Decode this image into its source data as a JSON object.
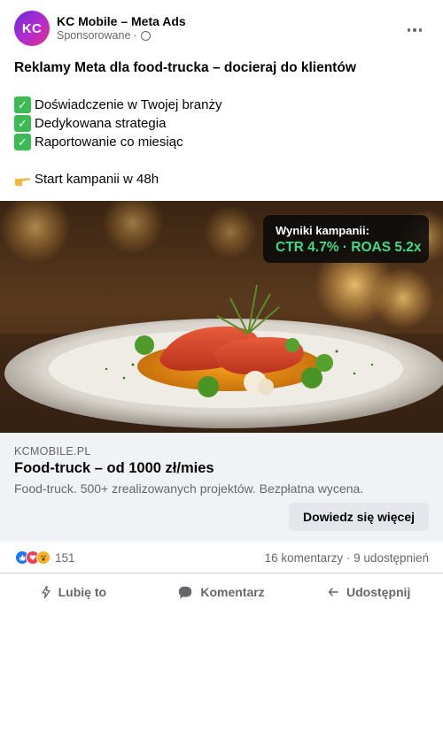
{
  "header": {
    "avatar_text": "KC",
    "page_name": "KC Mobile – Meta Ads",
    "sponsored": "Sponsorowane",
    "separator": "·"
  },
  "body": {
    "headline": "Reklamy Meta dla food-trucka – docieraj do klientów",
    "bullets": [
      "Doświadczenie w Twojej branży",
      "Dedykowana strategia",
      "Raportowanie co miesiąc"
    ],
    "cta_line": "Start kampanii w 48h"
  },
  "image": {
    "icon": "plated-dish-photo",
    "overlay_title": "Wyniki kampanii:",
    "overlay_value": "CTR 4.7% · ROAS 5.2x"
  },
  "link": {
    "domain": "KCMOBILE.PL",
    "title": "Food-truck – od 1000 zł/mies",
    "description": "Food-truck. 500+ zrealizowanych projektów. Bezpłatna wycena.",
    "cta_label": "Dowiedz się więcej"
  },
  "stats": {
    "reaction_count": "151",
    "comments_shares": "16 komentarzy · 9 udostępnień"
  },
  "actions": {
    "like": "Lubię to",
    "comment": "Komentarz",
    "share": "Udostępnij"
  },
  "colors": {
    "accent_green": "#3ddc84",
    "check_green": "#3cba54",
    "muted_text": "#65676b",
    "link_bg": "#f0f2f5"
  }
}
